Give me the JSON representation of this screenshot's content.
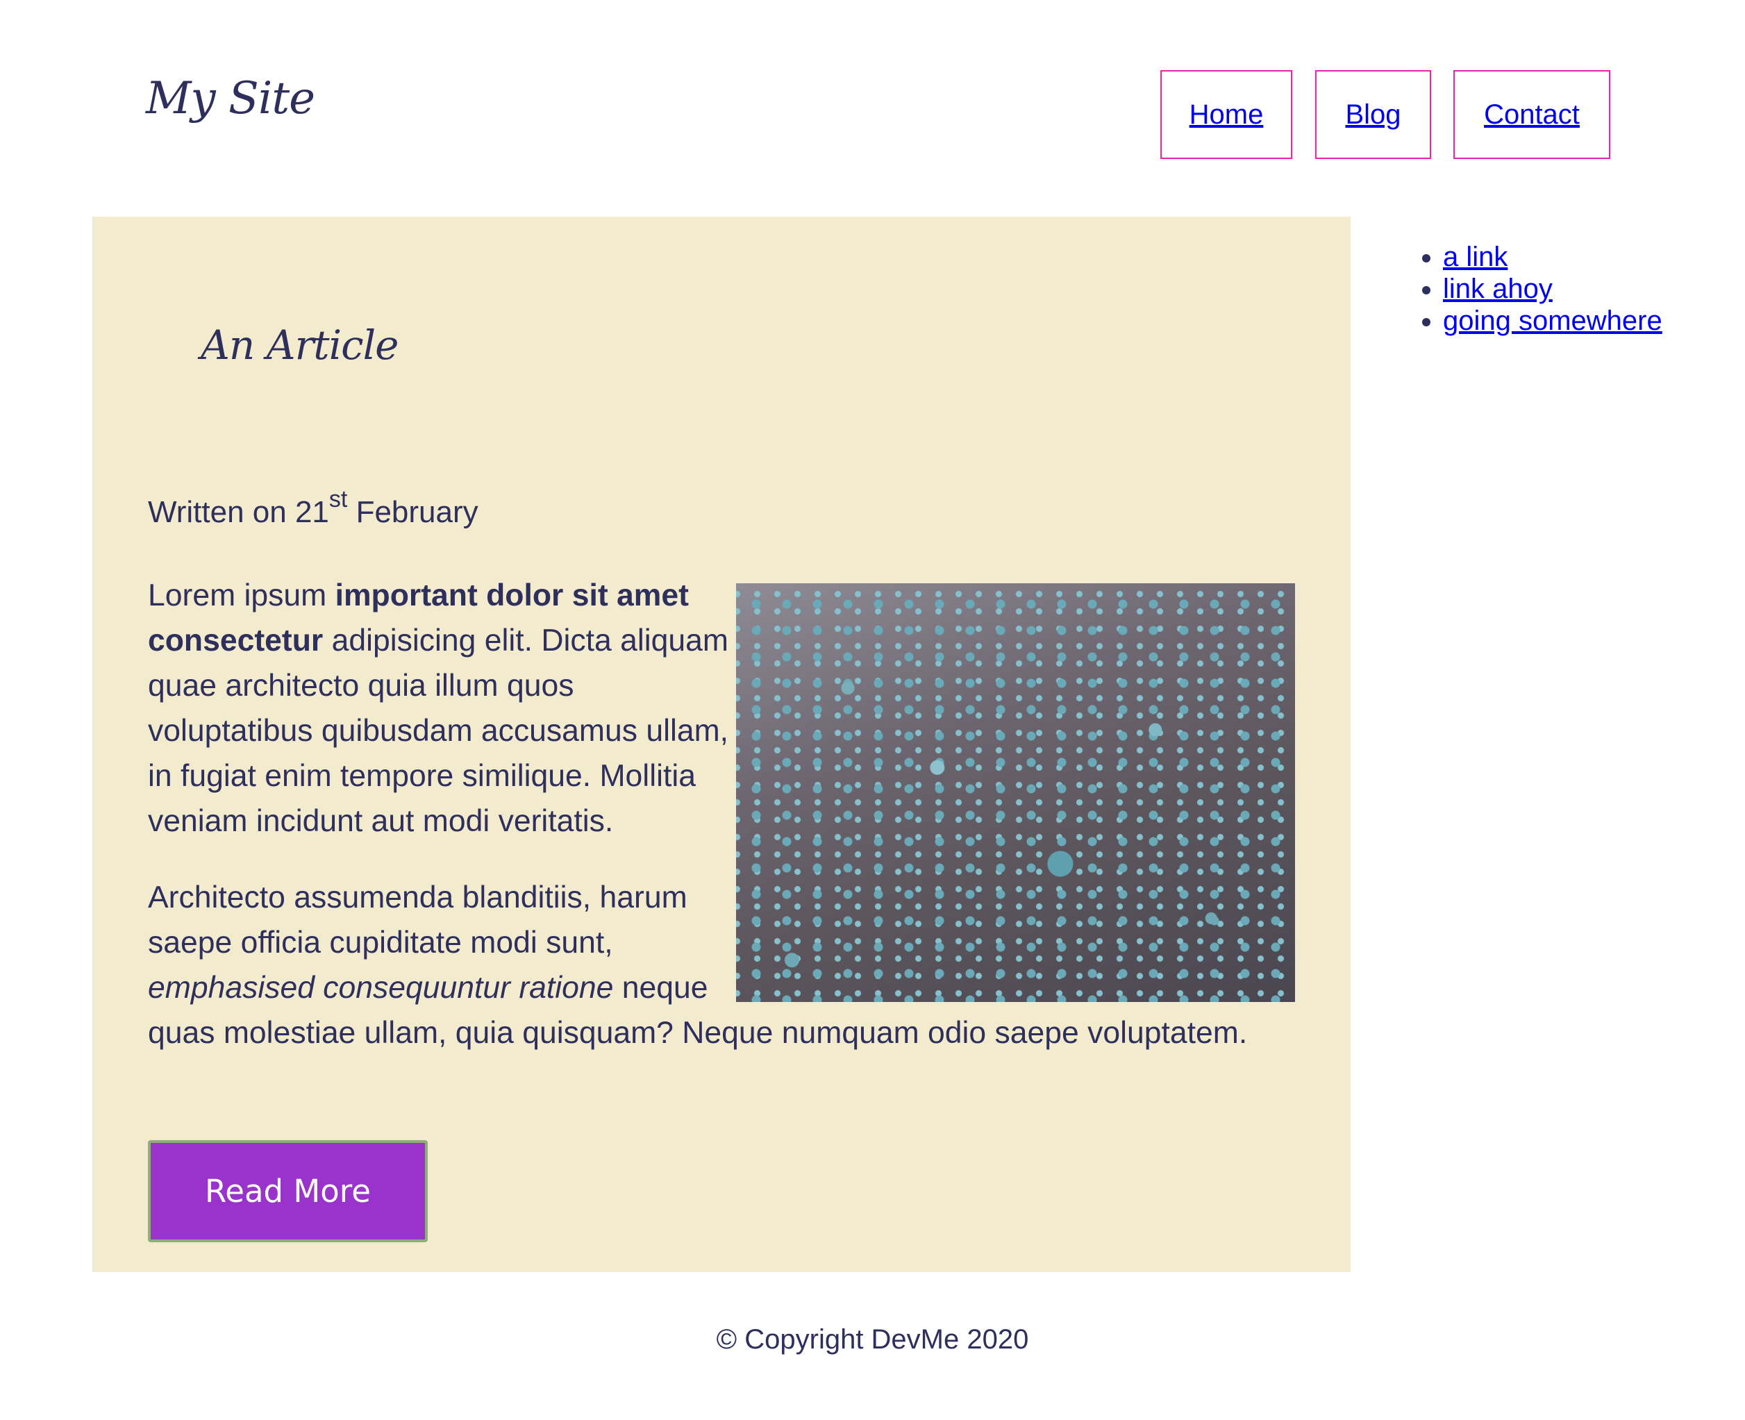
{
  "header": {
    "site_title": "My Site",
    "nav": [
      {
        "label": "Home"
      },
      {
        "label": "Blog"
      },
      {
        "label": "Contact"
      }
    ]
  },
  "article": {
    "title": "An Article",
    "written_prefix": "Written on 21",
    "written_sup": "st",
    "written_suffix": " February",
    "p1_start": "Lorem ipsum ",
    "p1_bold": "important dolor sit amet consectetur",
    "p1_rest": " adipisicing elit. Dicta aliquam quae architecto quia illum quos voluptatibus quibusdam accusamus ullam, in fugiat enim tempore similique. Mollitia veniam incidunt aut modi veritatis.",
    "p2_start": "Architecto assumenda blanditiis, harum saepe officia cupiditate modi sunt, ",
    "p2_em": "emphasised consequuntur ratione",
    "p2_rest": " neque quas molestiae ullam, quia quisquam? Neque numquam odio saepe voluptatem.",
    "read_more": "Read More"
  },
  "sidebar": {
    "links": [
      {
        "label": "a link"
      },
      {
        "label": "link ahoy"
      },
      {
        "label": "going somewhere"
      }
    ]
  },
  "footer": {
    "text": "© Copyright DevMe 2020"
  },
  "colors": {
    "text": "#2f2f5e",
    "article_bg": "#f2ebce",
    "nav_border": "#ee22aa",
    "link": "#0000ee",
    "button_bg": "#9933cc",
    "button_border": "#8fae79"
  }
}
